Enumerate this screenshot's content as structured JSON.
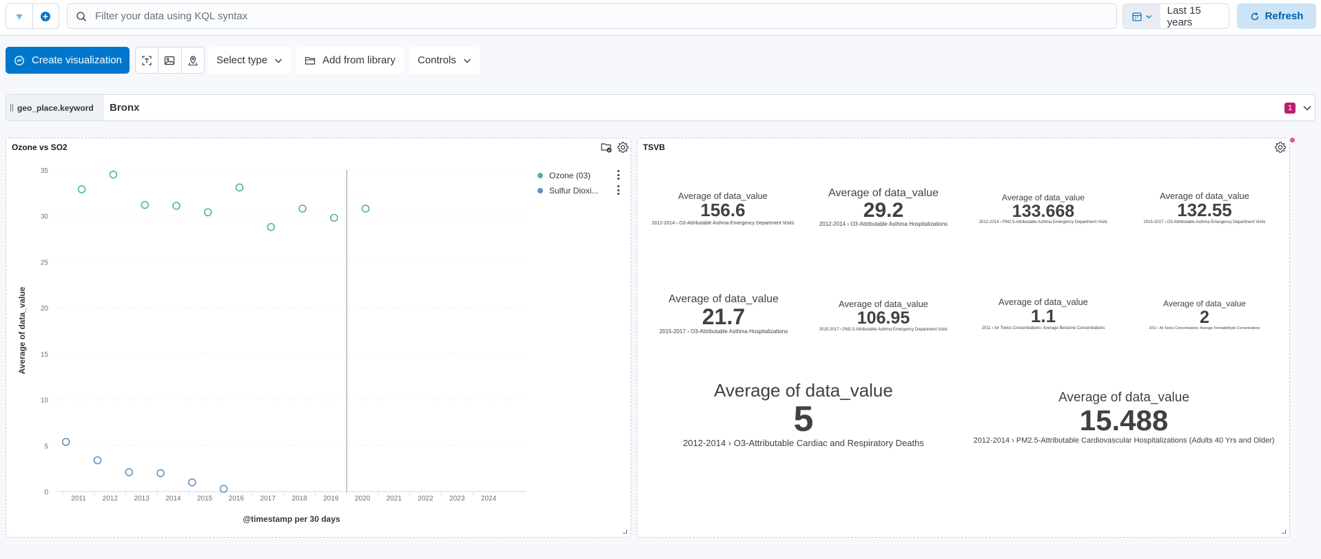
{
  "query": {
    "placeholder": "Filter your data using KQL syntax",
    "date_range": "Last 15 years",
    "refresh_label": "Refresh"
  },
  "toolbar": {
    "create_label": "Create visualization",
    "select_type_label": "Select type",
    "add_library_label": "Add from library",
    "controls_label": "Controls"
  },
  "control": {
    "field": "geo_place.keyword",
    "value": "Bronx",
    "count": "1"
  },
  "panels": {
    "left_title": "Ozone vs SO2",
    "right_title": "TSVB"
  },
  "colors": {
    "ozone": "#54b399",
    "so2": "#6092c0",
    "primary": "#0077cc",
    "notify": "#f04e98"
  },
  "chart_data": {
    "type": "scatter",
    "xlabel": "@timestamp per 30 days",
    "ylabel": "Average of data_value",
    "ylim": [
      0,
      35
    ],
    "yticks": [
      0,
      5,
      10,
      15,
      20,
      25,
      30,
      35
    ],
    "xticks": [
      "2011",
      "2012",
      "2013",
      "2014",
      "2015",
      "2016",
      "2017",
      "2018",
      "2019",
      "2020",
      "2021",
      "2022",
      "2023",
      "2024"
    ],
    "legend_position": "top-right",
    "current_time_marker": "2020",
    "series": [
      {
        "name": "Ozone (03)",
        "color": "#54b399",
        "points": [
          {
            "x": 2011.1,
            "y": 32.9
          },
          {
            "x": 2012.1,
            "y": 34.5
          },
          {
            "x": 2013.1,
            "y": 31.2
          },
          {
            "x": 2014.1,
            "y": 31.1
          },
          {
            "x": 2015.1,
            "y": 30.4
          },
          {
            "x": 2016.1,
            "y": 33.1
          },
          {
            "x": 2017.1,
            "y": 28.8
          },
          {
            "x": 2018.1,
            "y": 30.8
          },
          {
            "x": 2019.1,
            "y": 29.8
          },
          {
            "x": 2020.1,
            "y": 30.8
          }
        ]
      },
      {
        "name": "Sulfur Dioxi...",
        "color": "#6092c0",
        "points": [
          {
            "x": 2010.6,
            "y": 5.4
          },
          {
            "x": 2011.6,
            "y": 3.4
          },
          {
            "x": 2012.6,
            "y": 2.1
          },
          {
            "x": 2013.6,
            "y": 2.0
          },
          {
            "x": 2014.6,
            "y": 1.0
          },
          {
            "x": 2015.6,
            "y": 0.3
          }
        ]
      }
    ]
  },
  "metrics": [
    {
      "label": "Average of data_value",
      "value": "156.6",
      "sub": "2012-2014 › O3-Attributable Asthma Emergency Department Visits"
    },
    {
      "label": "Average of data_value",
      "value": "29.2",
      "sub": "2012-2014 › O3-Attributable Asthma Hospitalizations"
    },
    {
      "label": "Average of data_value",
      "value": "133.668",
      "sub": "2012-2014 › PM2.5-Attributable Asthma Emergency Department Visits"
    },
    {
      "label": "Average of data_value",
      "value": "132.55",
      "sub": "2015-2017 › O3-Attributable Asthma Emergency Department Visits"
    },
    {
      "label": "Average of data_value",
      "value": "21.7",
      "sub": "2015-2017 › O3-Attributable Asthma Hospitalizations"
    },
    {
      "label": "Average of data_value",
      "value": "106.95",
      "sub": "2015-2017 › PM2.5-Attributable Asthma Emergency Department Visits"
    },
    {
      "label": "Average of data_value",
      "value": "1.1",
      "sub": "2011 › Air Toxics Concentrations- Average Benzene Concentrations"
    },
    {
      "label": "Average of data_value",
      "value": "2",
      "sub": "2011 › Air Toxics Concentrations- Average Formaldehyde Concentrations"
    },
    {
      "label": "Average of data_value",
      "value": "5",
      "sub": "2012-2014 › O3-Attributable Cardiac and Respiratory Deaths"
    },
    {
      "label": "Average of data_value",
      "value": "15.488",
      "sub": "2012-2014 › PM2.5-Attributable Cardiovascular Hospitalizations (Adults 40 Yrs and Older)"
    }
  ]
}
